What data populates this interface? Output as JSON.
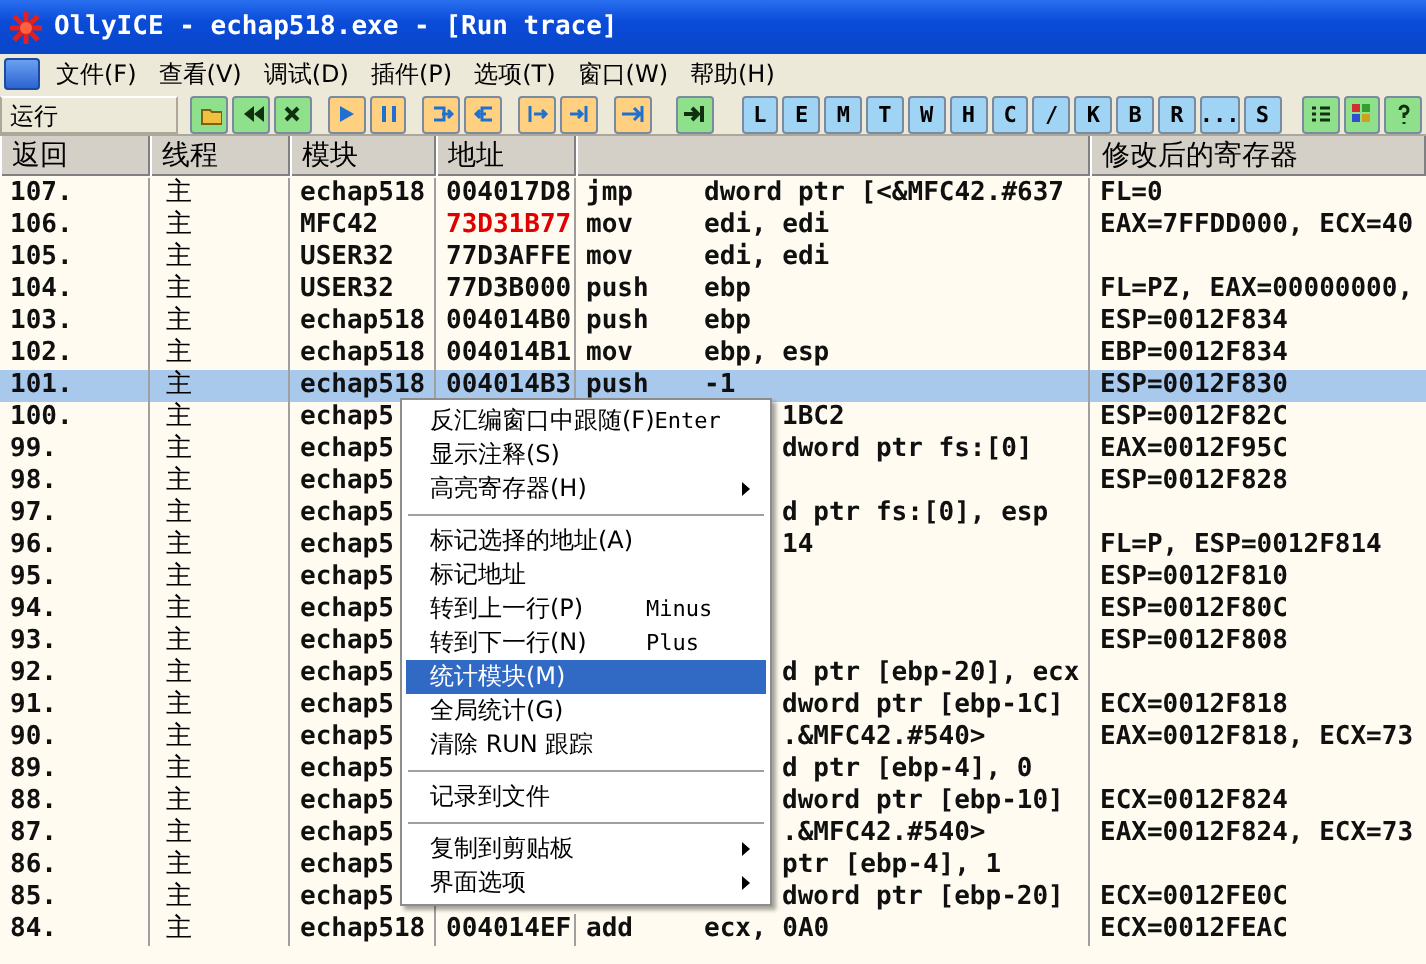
{
  "window": {
    "title": "OllyICE - echap518.exe - [Run trace]"
  },
  "menu": [
    "文件(F)",
    "查看(V)",
    "调试(D)",
    "插件(P)",
    "选项(T)",
    "窗口(W)",
    "帮助(H)"
  ],
  "toolbar": {
    "status": "运行",
    "letters": [
      "L",
      "E",
      "M",
      "T",
      "W",
      "H",
      "C",
      "/",
      "K",
      "B",
      "R",
      "...",
      "S"
    ]
  },
  "table": {
    "columns": [
      "返回",
      "线程",
      "模块",
      "地址",
      "",
      "修改后的寄存器"
    ],
    "rows": [
      {
        "kind": "full",
        "index": "107.",
        "thread": "主",
        "module": "echap518",
        "address": "004017D8",
        "address_changed": false,
        "opcode": "jmp",
        "operand": "dword ptr [<&MFC42.#637",
        "registers": "FL=0",
        "selected": false
      },
      {
        "kind": "full",
        "index": "106.",
        "thread": "主",
        "module": "MFC42",
        "address": "73D31B77",
        "address_changed": true,
        "opcode": "mov",
        "operand": "edi, edi",
        "registers": "EAX=7FFDD000, ECX=40",
        "selected": false
      },
      {
        "kind": "full",
        "index": "105.",
        "thread": "主",
        "module": "USER32",
        "address": "77D3AFFE",
        "address_changed": false,
        "opcode": "mov",
        "operand": "edi, edi",
        "registers": "",
        "selected": false
      },
      {
        "kind": "full",
        "index": "104.",
        "thread": "主",
        "module": "USER32",
        "address": "77D3B000",
        "address_changed": false,
        "opcode": "push",
        "operand": "ebp",
        "registers": "FL=PZ, EAX=00000000,",
        "selected": false
      },
      {
        "kind": "full",
        "index": "103.",
        "thread": "主",
        "module": "echap518",
        "address": "004014B0",
        "address_changed": false,
        "opcode": "push",
        "operand": "ebp",
        "registers": "ESP=0012F834",
        "selected": false
      },
      {
        "kind": "full",
        "index": "102.",
        "thread": "主",
        "module": "echap518",
        "address": "004014B1",
        "address_changed": false,
        "opcode": "mov",
        "operand": "ebp, esp",
        "registers": "EBP=0012F834",
        "selected": false
      },
      {
        "kind": "full",
        "index": "101.",
        "thread": "主",
        "module": "echap518",
        "address": "004014B3",
        "address_changed": false,
        "opcode": "push",
        "operand": "-1",
        "registers": "ESP=0012F830",
        "selected": true
      },
      {
        "kind": "covered",
        "index": "100.",
        "thread": "主",
        "module": "echap5",
        "operand": "1BC2",
        "registers": "ESP=0012F82C",
        "selected": false
      },
      {
        "kind": "covered",
        "index": "99.",
        "thread": "主",
        "module": "echap5",
        "operand": "dword ptr fs:[0]",
        "registers": "EAX=0012F95C",
        "selected": false
      },
      {
        "kind": "covered",
        "index": "98.",
        "thread": "主",
        "module": "echap5",
        "operand": "",
        "registers": "ESP=0012F828",
        "selected": false
      },
      {
        "kind": "covered",
        "index": "97.",
        "thread": "主",
        "module": "echap5",
        "operand": "d ptr fs:[0], esp",
        "registers": "",
        "selected": false
      },
      {
        "kind": "covered",
        "index": "96.",
        "thread": "主",
        "module": "echap5",
        "operand": "14",
        "registers": "FL=P, ESP=0012F814",
        "selected": false
      },
      {
        "kind": "covered",
        "index": "95.",
        "thread": "主",
        "module": "echap5",
        "operand": "",
        "registers": "ESP=0012F810",
        "selected": false
      },
      {
        "kind": "covered",
        "index": "94.",
        "thread": "主",
        "module": "echap5",
        "operand": "",
        "registers": "ESP=0012F80C",
        "selected": false
      },
      {
        "kind": "covered",
        "index": "93.",
        "thread": "主",
        "module": "echap5",
        "operand": "",
        "registers": "ESP=0012F808",
        "selected": false
      },
      {
        "kind": "covered",
        "index": "92.",
        "thread": "主",
        "module": "echap5",
        "operand": "d ptr [ebp-20], ecx",
        "registers": "",
        "selected": false
      },
      {
        "kind": "covered",
        "index": "91.",
        "thread": "主",
        "module": "echap5",
        "operand": "dword ptr [ebp-1C]",
        "registers": "ECX=0012F818",
        "selected": false
      },
      {
        "kind": "covered",
        "index": "90.",
        "thread": "主",
        "module": "echap5",
        "operand": ".&MFC42.#540>",
        "registers": "EAX=0012F818, ECX=73",
        "selected": false
      },
      {
        "kind": "covered",
        "index": "89.",
        "thread": "主",
        "module": "echap5",
        "operand": "d ptr [ebp-4], 0",
        "registers": "",
        "selected": false
      },
      {
        "kind": "covered",
        "index": "88.",
        "thread": "主",
        "module": "echap5",
        "operand": "dword ptr [ebp-10]",
        "registers": "ECX=0012F824",
        "selected": false
      },
      {
        "kind": "covered",
        "index": "87.",
        "thread": "主",
        "module": "echap5",
        "operand": ".&MFC42.#540>",
        "registers": "EAX=0012F824, ECX=73",
        "selected": false
      },
      {
        "kind": "covered",
        "index": "86.",
        "thread": "主",
        "module": "echap5",
        "operand": "ptr [ebp-4], 1",
        "registers": "",
        "selected": false
      },
      {
        "kind": "covered",
        "index": "85.",
        "thread": "主",
        "module": "echap5",
        "operand": "dword ptr [ebp-20]",
        "registers": "ECX=0012FE0C",
        "selected": false
      },
      {
        "kind": "full",
        "index": "84.",
        "thread": "主",
        "module": "echap518",
        "address": "004014EF",
        "address_changed": false,
        "opcode": "add",
        "operand": "ecx, 0A0",
        "registers": "ECX=0012FEAC",
        "selected": false
      }
    ]
  },
  "context_menu": [
    {
      "kind": "item",
      "label": "反汇编窗口中跟随(F)",
      "shortcut": "Enter",
      "submenu": false,
      "selected": false
    },
    {
      "kind": "item",
      "label": "显示注释(S)",
      "submenu": false,
      "selected": false
    },
    {
      "kind": "item",
      "label": "高亮寄存器(H)",
      "submenu": true,
      "selected": false
    },
    {
      "kind": "separator"
    },
    {
      "kind": "item",
      "label": "标记选择的地址(A)",
      "submenu": false,
      "selected": false
    },
    {
      "kind": "item",
      "label": "标记地址",
      "submenu": false,
      "selected": false
    },
    {
      "kind": "item",
      "label": "转到上一行(P)",
      "shortcut": "Minus",
      "submenu": false,
      "selected": false
    },
    {
      "kind": "item",
      "label": "转到下一行(N)",
      "shortcut": "Plus",
      "submenu": false,
      "selected": false
    },
    {
      "kind": "item",
      "label": "统计模块(M)",
      "submenu": false,
      "selected": true
    },
    {
      "kind": "item",
      "label": "全局统计(G)",
      "submenu": false,
      "selected": false
    },
    {
      "kind": "item",
      "label": "清除 RUN 跟踪",
      "submenu": false,
      "selected": false
    },
    {
      "kind": "separator"
    },
    {
      "kind": "item",
      "label": "记录到文件",
      "submenu": false,
      "selected": false
    },
    {
      "kind": "separator"
    },
    {
      "kind": "item",
      "label": "复制到剪贴板",
      "submenu": true,
      "selected": false
    },
    {
      "kind": "item",
      "label": "界面选项",
      "submenu": true,
      "selected": false
    }
  ]
}
